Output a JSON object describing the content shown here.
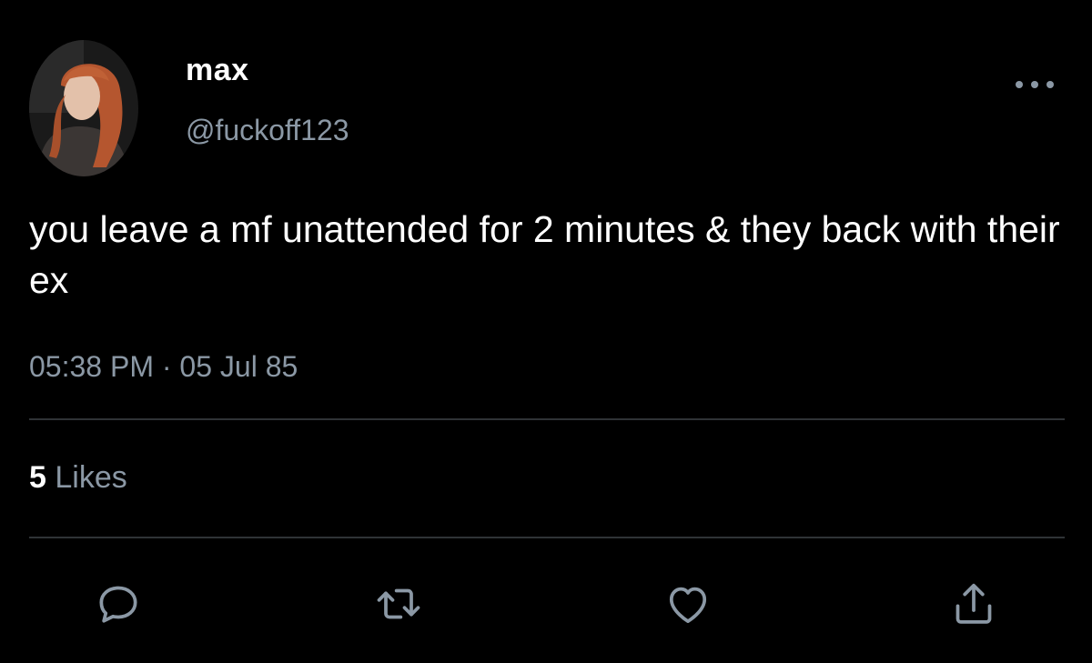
{
  "tweet": {
    "display_name": "max",
    "handle": "@fuckoff123",
    "text": "you leave a mf unattended for 2 minutes & they back with their ex",
    "time": "05:38 PM",
    "separator": "·",
    "date": "05 Jul 85",
    "likes_count": "5",
    "likes_label": "Likes"
  },
  "icons": {
    "more": "more-horizontal-icon",
    "reply": "reply-icon",
    "retweet": "retweet-icon",
    "like": "heart-icon",
    "share": "share-icon"
  },
  "colors": {
    "background": "#000000",
    "text": "#ffffff",
    "secondary": "#8b98a5",
    "divider": "#2f3336"
  }
}
